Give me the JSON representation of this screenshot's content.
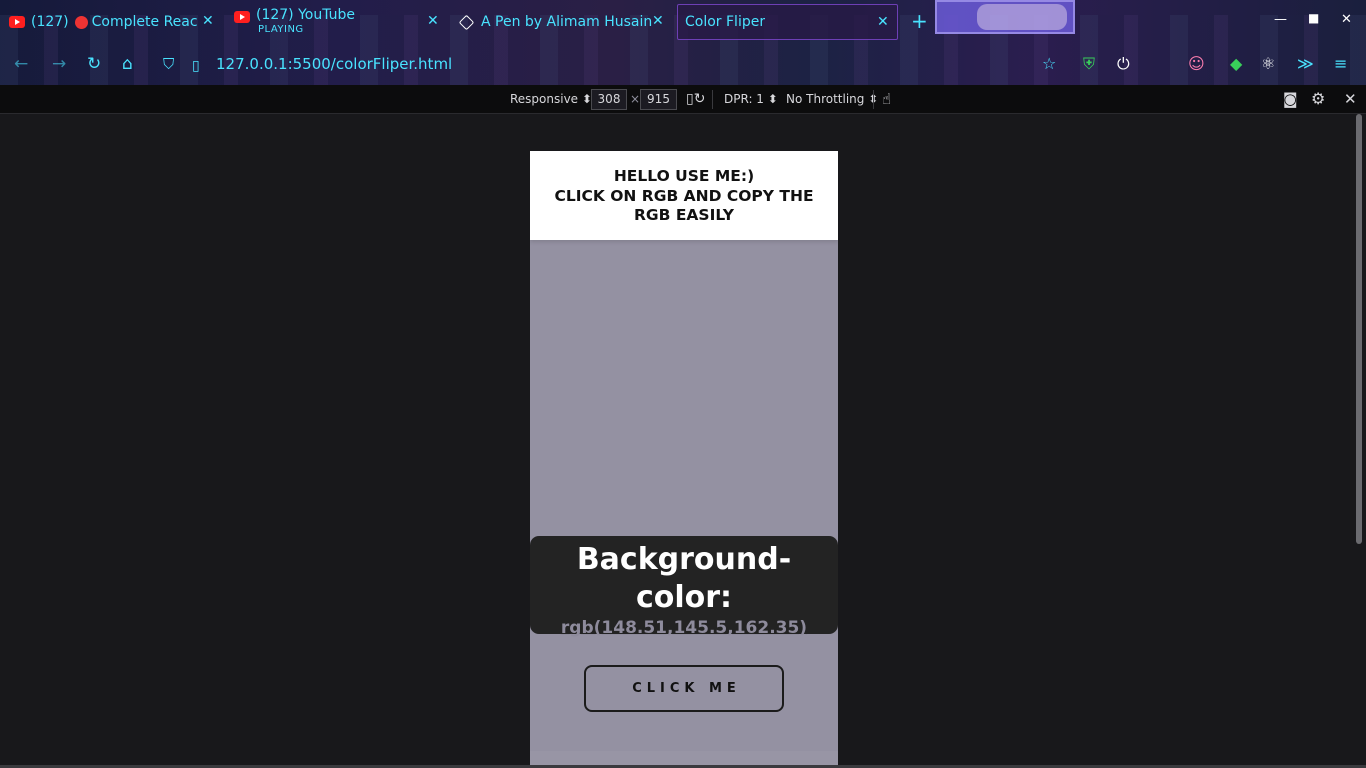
{
  "browser": {
    "tabs": [
      {
        "count": "(127)",
        "title": "Complete React",
        "subtitle": ""
      },
      {
        "count": "",
        "title": "(127) YouTube",
        "subtitle": "PLAYING"
      },
      {
        "count": "",
        "title": "A Pen by Alimam Husain",
        "subtitle": ""
      },
      {
        "count": "",
        "title": "Color Fliper",
        "subtitle": ""
      }
    ],
    "url": "127.0.0.1:5500/colorFliper.html",
    "new_tab": "+"
  },
  "responsive_bar": {
    "mode": "Responsive",
    "width": "308",
    "times": "×",
    "height": "915",
    "dpr": "DPR: 1",
    "throttling": "No Throttling"
  },
  "page": {
    "background": "rgb(148,145,162)",
    "header_line1": "HELLO USE ME:)",
    "header_line2": "CLICK ON RGB AND COPY THE",
    "header_line3": "RGB EASILY",
    "card_title_1": "Background-",
    "card_title_2": "color:",
    "rgb_value": "rgb(148.51,145.5,162.35)",
    "button_label": "CLICK ME"
  },
  "colors": {
    "accent": "#49e3ff",
    "card": "#232323",
    "viewport": "#18181b"
  }
}
